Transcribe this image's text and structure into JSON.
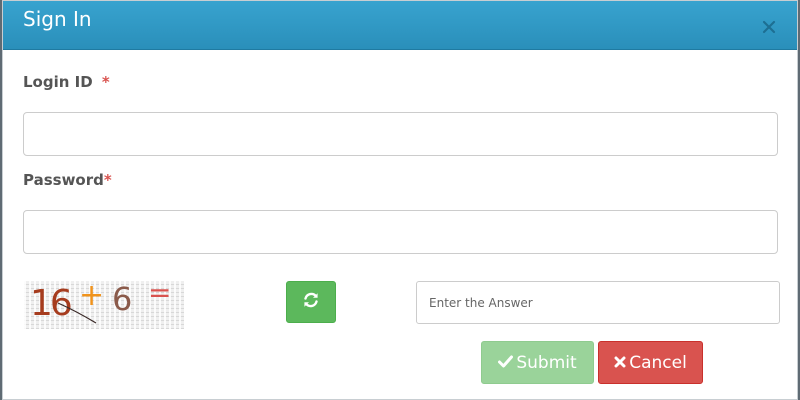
{
  "dialog": {
    "title": "Sign In",
    "close_icon": "close-icon"
  },
  "form": {
    "login_label": "Login ID",
    "login_required": "*",
    "login_value": "",
    "password_label": "Password",
    "password_required": "*",
    "password_value": ""
  },
  "captcha": {
    "operand1": "16",
    "operator": "+",
    "operand2": "6",
    "equals": "=",
    "refresh_icon": "refresh-icon",
    "answer_placeholder": "Enter the Answer",
    "answer_value": ""
  },
  "actions": {
    "submit_label": "Submit",
    "submit_icon": "check-icon",
    "cancel_label": "Cancel",
    "cancel_icon": "times-icon"
  },
  "colors": {
    "header": "#2a8fba",
    "required": "#d9534f",
    "success": "#5cb85c",
    "submit_disabled": "#9ad39a",
    "danger": "#d9534f",
    "captcha_number": "#a63c1e",
    "captcha_operator": "#f0931c",
    "captcha_number2": "#8a5a4a",
    "captcha_equals": "#d9534f"
  }
}
